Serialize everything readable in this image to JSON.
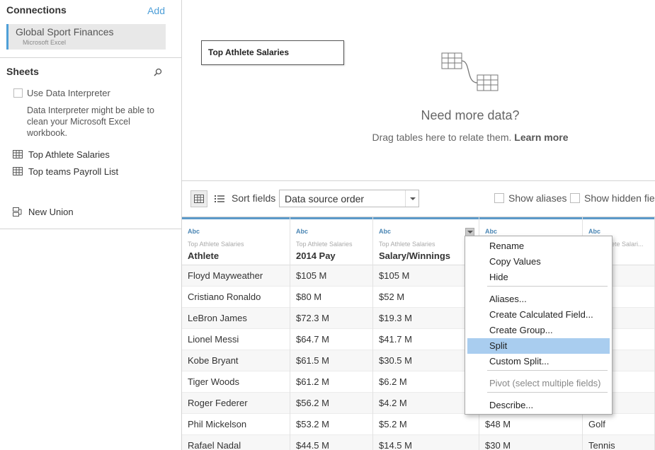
{
  "connections": {
    "title": "Connections",
    "add_label": "Add",
    "items": [
      {
        "name": "Global Sport Finances",
        "type": "Microsoft Excel"
      }
    ]
  },
  "sheets": {
    "title": "Sheets",
    "use_interpreter_label": "Use Data Interpreter",
    "interpreter_description": "Data Interpreter might be able to clean your Microsoft Excel workbook.",
    "items": [
      "Top Athlete Salaries",
      "Top teams Payroll List"
    ],
    "new_union_label": "New Union"
  },
  "canvas": {
    "table_name": "Top Athlete Salaries",
    "need_more": "Need more data?",
    "drag_text": "Drag tables here to relate them.",
    "learn_more": "Learn more"
  },
  "toolbar": {
    "sort_label": "Sort fields",
    "sort_value": "Data source order",
    "show_aliases": "Show aliases",
    "show_hidden": "Show hidden fields"
  },
  "grid": {
    "columns": [
      {
        "type": "Abc",
        "source": "Top Athlete Salaries",
        "name": "Athlete"
      },
      {
        "type": "Abc",
        "source": "Top Athlete Salaries",
        "name": "2014 Pay"
      },
      {
        "type": "Abc",
        "source": "Top Athlete Salaries",
        "name": "Salary/Winnings"
      },
      {
        "type": "Abc",
        "source": "",
        "name": ""
      },
      {
        "type": "Abc",
        "source": "Top Athlete Salari...",
        "name": ""
      }
    ],
    "rows": [
      [
        "Floyd Mayweather",
        "$105 M",
        "$105 M",
        "",
        "g"
      ],
      [
        "Cristiano Ronaldo",
        "$80 M",
        "$52 M",
        "",
        "r"
      ],
      [
        "LeBron James",
        "$72.3 M",
        "$19.3 M",
        "",
        "tball"
      ],
      [
        "Lionel Messi",
        "$64.7 M",
        "$41.7 M",
        "",
        "r"
      ],
      [
        "Kobe Bryant",
        "$61.5 M",
        "$30.5 M",
        "",
        "tball"
      ],
      [
        "Tiger Woods",
        "$61.2 M",
        "$6.2 M",
        "",
        ""
      ],
      [
        "Roger Federer",
        "$56.2 M",
        "$4.2 M",
        "",
        "s"
      ],
      [
        "Phil Mickelson",
        "$53.2 M",
        "$5.2 M",
        "$48 M",
        "Golf"
      ],
      [
        "Rafael Nadal",
        "$44.5 M",
        "$14.5 M",
        "$30 M",
        "Tennis"
      ]
    ]
  },
  "context_menu": {
    "items": [
      "Rename",
      "Copy Values",
      "Hide",
      "Aliases...",
      "Create Calculated Field...",
      "Create Group...",
      "Split",
      "Custom Split...",
      "Pivot (select multiple fields)",
      "Describe..."
    ],
    "highlighted": "Split",
    "disabled": "Pivot (select multiple fields)"
  },
  "colors": {
    "accent": "#4e9fd8",
    "header_bar": "#5c9ac9",
    "menu_highlight": "#a9cdef"
  },
  "icons": [
    "search-icon",
    "table-icon",
    "union-icon",
    "relate-tables-icon",
    "grid-view-icon",
    "list-view-icon",
    "dropdown-arrow-icon"
  ]
}
